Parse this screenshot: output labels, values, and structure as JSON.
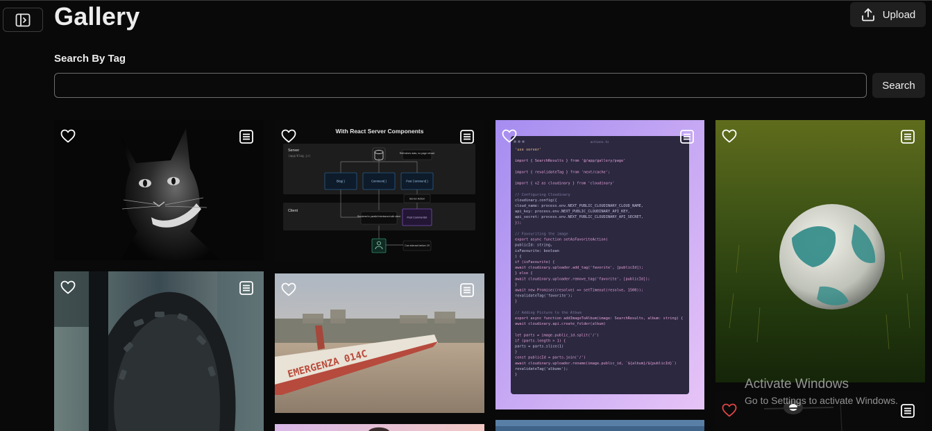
{
  "header": {
    "title": "Gallery",
    "upload_label": "Upload"
  },
  "search": {
    "label": "Search By Tag",
    "value": "",
    "placeholder": "",
    "button_label": "Search"
  },
  "gallery": {
    "images": [
      {
        "subject": "black and white cat",
        "favourite": false
      },
      {
        "subject": "react server components diagram",
        "favourite": false
      },
      {
        "subject": "code screenshot",
        "favourite": false
      },
      {
        "subject": "soccer ball on grass",
        "favourite": false
      },
      {
        "subject": "bike tire",
        "favourite": false
      },
      {
        "subject": "beach boat",
        "favourite": false
      },
      {
        "subject": "night scene",
        "favourite": true
      }
    ]
  },
  "diagram_text": {
    "title": "With React Server Components",
    "server": "Server",
    "server_path": "(app/blog.js)",
    "client": "Client",
    "db_note": "Refreshes data, no page reload",
    "box1": "Blog( )",
    "box2": "Comment( )",
    "box3": "Post Comment( )",
    "server_action": "Server Action",
    "rendered_note": "Rendered in parallel interleaved with client",
    "post_comment_ui": "Post CommentUI",
    "get_interact": "Can interact before JS"
  },
  "code_text": {
    "filename": "actions.ts",
    "lines": [
      "'use server'",
      "",
      "import { SearchResults } from '@/app/gallery/page'",
      "",
      "import { revalidateTag } from 'next/cache';",
      "",
      "import { v2 as cloudinary } from 'cloudinary'",
      "",
      "// Configuring Cloudinary",
      "cloudinary.config({",
      "  cloud_name: process.env.NEXT_PUBLIC_CLOUDINARY_CLOUD_NAME,",
      "  api_key: process.env.NEXT_PUBLIC_CLOUDINARY_API_KEY,",
      "  api_secret: process.env.NEXT_PUBLIC_CLOUDINARY_API_SECRET,",
      "});",
      "",
      "// Favouriting the image",
      "export async function setAsFavoriteAction(",
      "  publicId: string,",
      "  isFavourite: boolean",
      ") {",
      "  if (isFavourite) {",
      "    await cloudinary.uploader.add_tag('favorite', [publicId]);",
      "  } else {",
      "    await cloudinary.uploader.remove_tag('favorite', [publicId]);",
      "  }",
      "  await new Promise((resolve) => setTimeout(resolve, 1500));",
      "  revalidateTag('favorite');",
      "}",
      "",
      "// Adding Picture to the Album",
      "export async function addImageToAlbum(image: SearchResults, album: string) {",
      "  await cloudinary.api.create_folder(album)",
      "",
      "  let parts = image.public_id.split('/')",
      "  if (parts.length > 1) {",
      "    parts = parts.slice(1)",
      "  }",
      "  const publicId = parts.join('/')",
      "  await cloudinary.uploader.rename(image.public_id, `${album}/${publicId}`)",
      "  revalidateTag('albums');",
      "}"
    ]
  },
  "boat_text": "EMERGENZA 014C",
  "watermark": {
    "title": "Activate Windows",
    "subtitle": "Go to Settings to activate Windows."
  },
  "colors": {
    "background": "#090909",
    "heart_active": "#e04545",
    "button_bg": "#1f1f1f",
    "code_bg": "#2a2740",
    "code_frame": "#c9a8f5"
  },
  "icons": {
    "sidebar_toggle": "panel-left-icon",
    "upload": "upload-icon",
    "favourite": "heart-icon",
    "menu": "menu-icon"
  }
}
